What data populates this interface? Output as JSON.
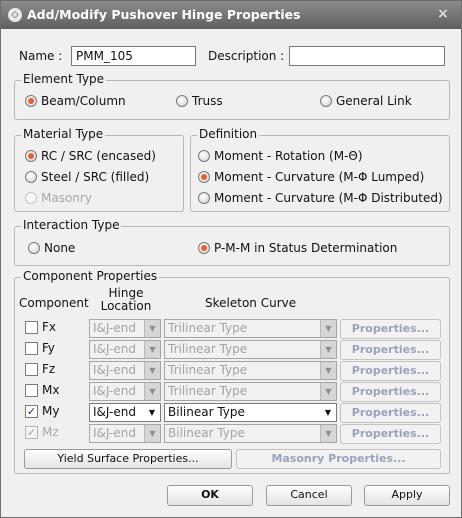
{
  "window": {
    "title": "Add/Modify Pushover Hinge Properties",
    "close": "×"
  },
  "header": {
    "name_label": "Name :",
    "name_value": "PMM_105",
    "description_label": "Description :",
    "description_value": ""
  },
  "element_type": {
    "title": "Element Type",
    "options": [
      "Beam/Column",
      "Truss",
      "General Link"
    ],
    "selected": "Beam/Column"
  },
  "material_type": {
    "title": "Material Type",
    "options": [
      "RC / SRC (encased)",
      "Steel / SRC (filled)",
      "Masonry"
    ],
    "selected": "RC / SRC (encased)"
  },
  "definition": {
    "title": "Definition",
    "options": [
      "Moment - Rotation (M-Θ)",
      "Moment - Curvature (M-Φ Lumped)",
      "Moment - Curvature (M-Φ Distributed)"
    ],
    "selected": "Moment - Curvature (M-Φ Lumped)"
  },
  "interaction_type": {
    "title": "Interaction Type",
    "options": [
      "None",
      "P-M-M in Status Determination"
    ],
    "selected": "P-M-M in Status Determination"
  },
  "component_properties": {
    "title": "Component Properties",
    "col_component": "Component",
    "col_hinge_location": "Hinge Location",
    "col_skeleton_curve": "Skeleton Curve",
    "rows": [
      {
        "component": "Fx",
        "location": "I&J-end",
        "curve": "Trilinear Type",
        "properties": "Properties...",
        "checked": false,
        "enabled": false
      },
      {
        "component": "Fy",
        "location": "I&J-end",
        "curve": "Trilinear Type",
        "properties": "Properties...",
        "checked": false,
        "enabled": false
      },
      {
        "component": "Fz",
        "location": "I&J-end",
        "curve": "Trilinear Type",
        "properties": "Properties...",
        "checked": false,
        "enabled": false
      },
      {
        "component": "Mx",
        "location": "I&J-end",
        "curve": "Trilinear Type",
        "properties": "Properties...",
        "checked": false,
        "enabled": false
      },
      {
        "component": "My",
        "location": "I&J-end",
        "curve": "Bilinear Type",
        "properties": "Properties...",
        "checked": true,
        "enabled": true
      },
      {
        "component": "Mz",
        "location": "I&J-end",
        "curve": "Bilinear Type",
        "properties": "Properties...",
        "checked": true,
        "enabled": false
      }
    ],
    "yield_surface_button": "Yield Surface Properties...",
    "masonry_button": "Masonry Properties..."
  },
  "footer": {
    "ok": "OK",
    "cancel": "Cancel",
    "apply": "Apply"
  },
  "colors": {
    "title_bar": "#6f6f6f",
    "radio_selected": "#e2642c",
    "disabled_text": "#a9a9a9"
  }
}
